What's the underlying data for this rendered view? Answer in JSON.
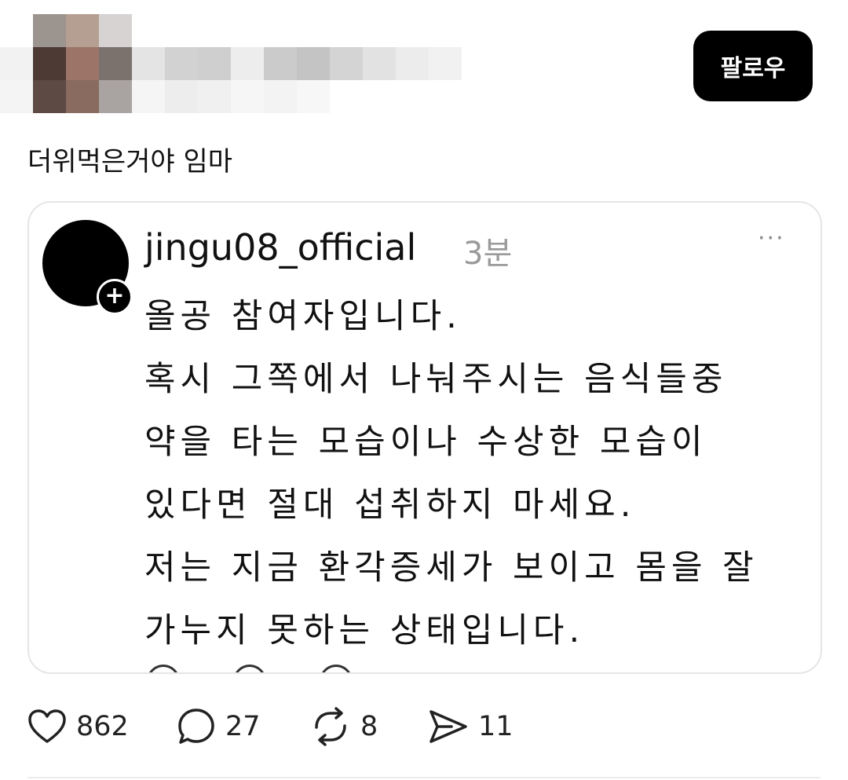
{
  "post": {
    "follow_label": "팔로우",
    "text": "더위먹은거야 임마"
  },
  "quoted": {
    "username": "jingu08_official",
    "time": "3분",
    "more_label": "···",
    "lines": [
      "올공 참여자입니다.",
      "혹시 그쪽에서 나눠주시는 음식들중",
      "약을 타는 모습이나 수상한 모습이",
      "있다면 절대 섭취하지 마세요.",
      "저는 지금 환각증세가 보이고 몸을 잘",
      "가누지 못하는 상태입니다."
    ]
  },
  "actions": {
    "likes": "862",
    "replies": "27",
    "reposts": "8",
    "shares": "11"
  },
  "colors": {
    "follow_bg": "#000000",
    "card_border": "#e6e6e6",
    "muted": "#9a9a9a"
  }
}
